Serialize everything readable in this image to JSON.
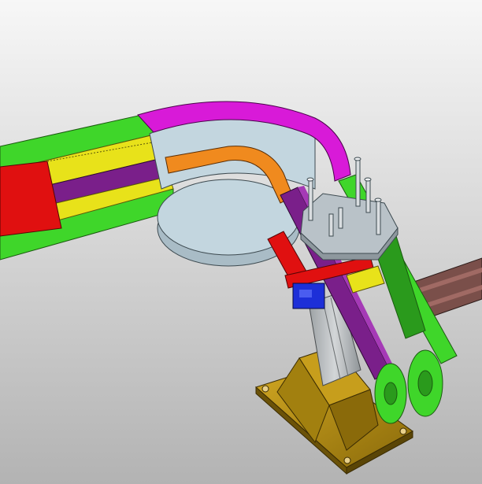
{
  "viewport": {
    "description_visible_text": "",
    "colors": {
      "background_top": "#f7f7f7",
      "background_bottom": "#b3b3b3",
      "conveyor_green": "#3fd62a",
      "conveyor_green_dark": "#2a9a1c",
      "curve_magenta": "#d81ad8",
      "purple_track": "#7a1f8a",
      "red_block": "#e01010",
      "yellow_guide": "#e8e21a",
      "orange_guide": "#f08a1e",
      "turntable_gray": "#c3d6df",
      "plate_gray": "#b9c2c8",
      "column_gray": "#b8bcbe",
      "base_bronze": "#b08a10",
      "base_bronze_dark": "#7a5e08",
      "blue_block": "#1d2fd8",
      "brown_rail": "#7a4f4a"
    }
  }
}
